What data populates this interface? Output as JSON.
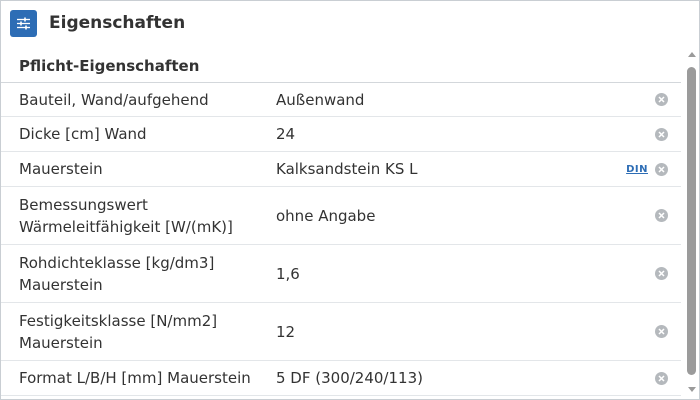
{
  "panel": {
    "title": "Eigenschaften",
    "icon": "sliders-icon"
  },
  "section": {
    "title": "Pflicht-Eigenschaften"
  },
  "rows": [
    {
      "label": "Bauteil, Wand/aufgehend",
      "value": "Außenwand"
    },
    {
      "label": "Dicke [cm] Wand",
      "value": "24"
    },
    {
      "label": "Mauerstein",
      "value": "Kalksandstein KS L",
      "badge": "DIN"
    },
    {
      "label": "Bemessungswert Wärmeleitfähigkeit [W/(mK)]",
      "value": "ohne Angabe"
    },
    {
      "label": "Rohdichteklasse [kg/dm3] Mauerstein",
      "value": "1,6"
    },
    {
      "label": "Festigkeitsklasse [N/mm2] Mauerstein",
      "value": "12"
    },
    {
      "label": "Format L/B/H [mm] Mauerstein",
      "value": "5 DF (300/240/113)"
    }
  ],
  "colors": {
    "accent": "#2d6db5",
    "clear_icon": "#b5b9bd",
    "scroll_thumb": "#9b9b9b"
  }
}
